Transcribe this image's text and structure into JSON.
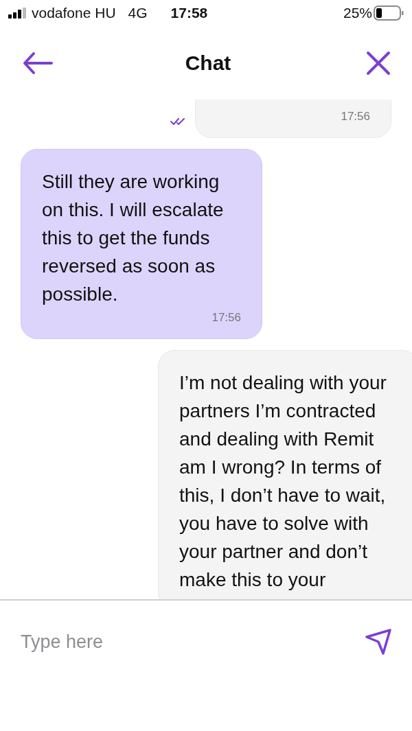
{
  "status_bar": {
    "carrier": "vodafone HU",
    "network": "4G",
    "time": "17:58",
    "battery": "25%"
  },
  "header": {
    "title": "Chat"
  },
  "messages": [
    {
      "kind": "sent",
      "time": "17:56",
      "read": true
    },
    {
      "kind": "received",
      "text": "Still they are working on this. I will escalate this to get the funds reversed as soon as possible.",
      "time": "17:56"
    },
    {
      "kind": "sent",
      "text": "I’m not dealing with your partners I’m contracted and dealing with Remit am I wrong? In terms of this, I don’t have to wait, you have to solve with your partner and don’t make this to your"
    }
  ],
  "composer": {
    "placeholder": "Type here"
  }
}
